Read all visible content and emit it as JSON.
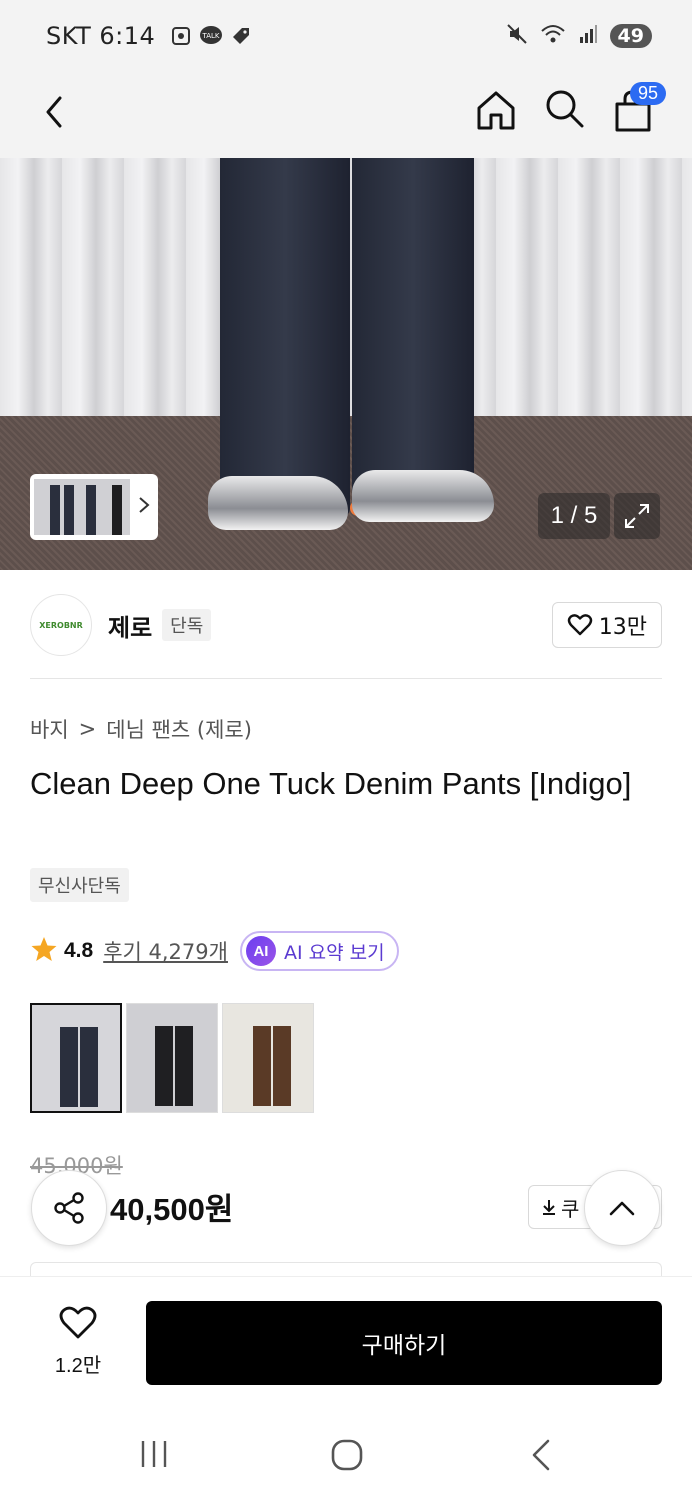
{
  "status_bar": {
    "carrier_time": "SKT 6:14",
    "battery": "49"
  },
  "nav": {
    "cart_badge": "95"
  },
  "gallery": {
    "counter": "1 / 5"
  },
  "brand": {
    "logo_text": "XEROBNR",
    "name": "제로",
    "exclusive_tag": "단독",
    "like_count": "13만"
  },
  "breadcrumb": {
    "category": "바지",
    "separator": ">",
    "subcategory": "데님 팬츠 (제로)"
  },
  "product": {
    "title": "Clean Deep One Tuck Denim Pants [Indigo]",
    "tag": "무신사단독",
    "rating": "4.8",
    "reviews": "후기 4,279개",
    "ai_badge": "AI",
    "ai_summary": "AI 요약 보기",
    "original_price": "45,000원",
    "price": "40,500원",
    "coupon_label": "쿠"
  },
  "variants": [
    {
      "name": "Indigo",
      "color": "#2a2f3d",
      "bg": "#d6d6da"
    },
    {
      "name": "Black",
      "color": "#1f1f22",
      "bg": "#cfcfd3"
    },
    {
      "name": "Brown",
      "color": "#5a3a26",
      "bg": "#e8e6e0"
    }
  ],
  "bottom": {
    "wish_count": "1.2만",
    "buy_label": "구매하기"
  },
  "colors": {
    "accent_purple": "#5b3bd1",
    "badge_blue": "#2c6bf2",
    "star": "#f5a623"
  }
}
